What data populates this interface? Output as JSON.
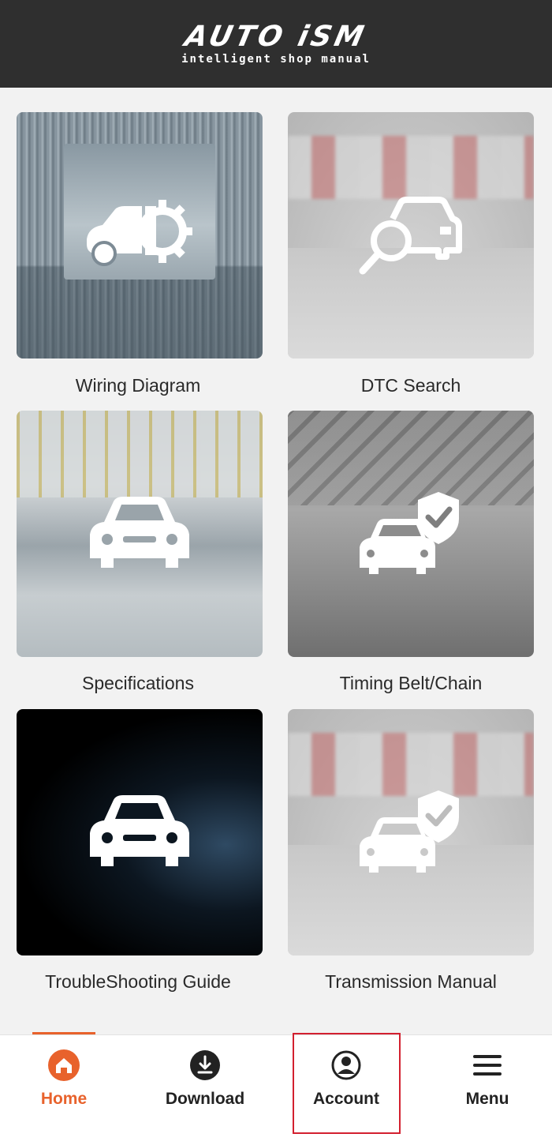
{
  "header": {
    "logo_main": "AUTO iSM",
    "logo_sub": "intelligent shop manual"
  },
  "tiles": [
    {
      "label": "Wiring Diagram",
      "icon": "car-gear-icon"
    },
    {
      "label": "DTC Search",
      "icon": "car-search-icon"
    },
    {
      "label": "Specifications",
      "icon": "car-front-icon"
    },
    {
      "label": "Timing Belt/Chain",
      "icon": "car-shield-check-icon"
    },
    {
      "label": "TroubleShooting Guide",
      "icon": "car-front-icon"
    },
    {
      "label": "Transmission Manual",
      "icon": "car-shield-check-icon"
    }
  ],
  "nav": {
    "items": [
      {
        "label": "Home",
        "icon": "home-icon",
        "active": true
      },
      {
        "label": "Download",
        "icon": "download-icon",
        "active": false
      },
      {
        "label": "Account",
        "icon": "account-icon",
        "active": false
      },
      {
        "label": "Menu",
        "icon": "menu-icon",
        "active": false
      }
    ]
  },
  "colors": {
    "header_bg": "#2f2f2f",
    "accent": "#e8622c",
    "highlight_border": "#d3202f",
    "page_bg": "#f2f2f2"
  }
}
